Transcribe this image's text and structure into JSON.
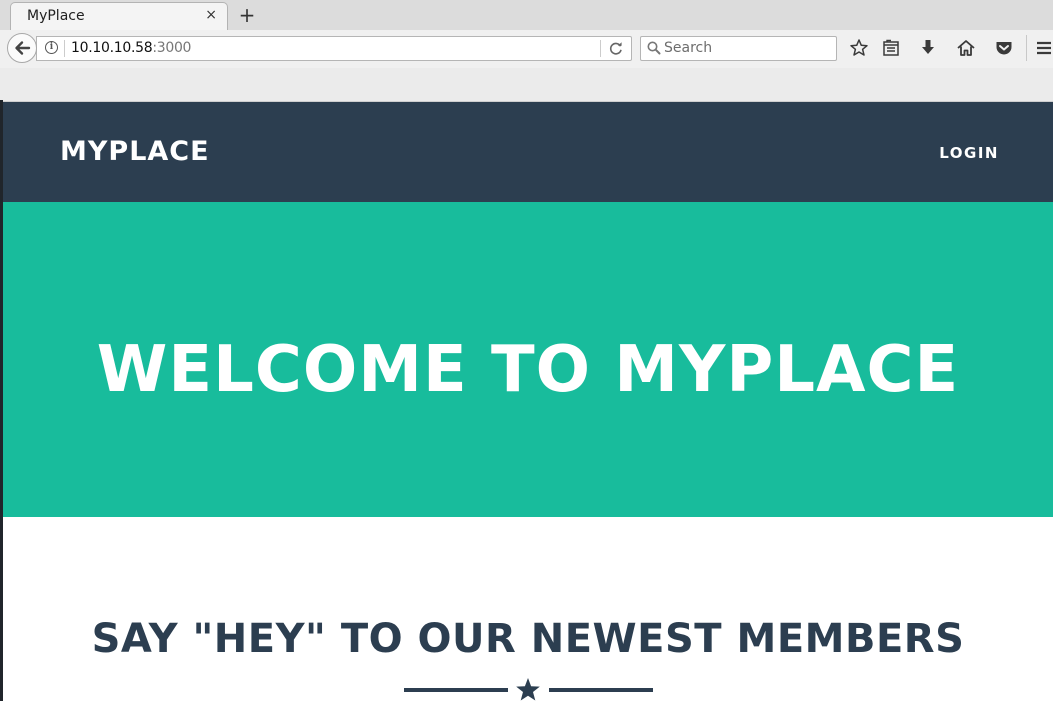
{
  "browser": {
    "tab": {
      "title": "MyPlace",
      "close_glyph": "×"
    },
    "new_tab_glyph": "+",
    "url": {
      "host": "10.10.10.58",
      "port": ":3000"
    },
    "search": {
      "placeholder": "Search"
    },
    "icons": [
      "back-arrow-icon",
      "info-icon",
      "reload-icon",
      "search-icon",
      "bookmark-star-icon",
      "reading-list-icon",
      "download-icon",
      "home-icon",
      "pocket-icon",
      "menu-icon"
    ]
  },
  "site": {
    "brand": "MYPLACE",
    "nav": {
      "login": "LOGIN"
    },
    "hero": {
      "title": "WELCOME TO MYPLACE"
    },
    "section": {
      "title": "SAY \"HEY\" TO OUR NEWEST MEMBERS"
    },
    "colors": {
      "primary": "#2c3e50",
      "accent": "#18bc9c",
      "white": "#ffffff"
    }
  }
}
